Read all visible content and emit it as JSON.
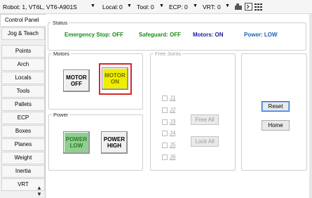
{
  "toolbar": {
    "robot_label": "Robot: 1, VT6L, VT6-A901S",
    "local_label": "Local:",
    "local_value": "0",
    "tool_label": "Tool:",
    "tool_value": "0",
    "ecp_label": "ECP:",
    "ecp_value": "0",
    "vrt_label": "VRT:",
    "vrt_value": "0",
    "arrow": "▼"
  },
  "sidebar": {
    "items": [
      {
        "label": "Control Panel"
      },
      {
        "label": "Jog & Teach"
      },
      {
        "label": "Points"
      },
      {
        "label": "Arch"
      },
      {
        "label": "Locals"
      },
      {
        "label": "Tools"
      },
      {
        "label": "Pallets"
      },
      {
        "label": "ECP"
      },
      {
        "label": "Boxes"
      },
      {
        "label": "Planes"
      },
      {
        "label": "Weight"
      },
      {
        "label": "Inertia"
      },
      {
        "label": "VRT"
      }
    ]
  },
  "status": {
    "title": "Status",
    "emergency_stop": "Emergency Stop: OFF",
    "safeguard": "Safeguard: OFF",
    "motors": "Motors: ON",
    "power": "Power: LOW",
    "colors": {
      "ok": "#1a8a1a",
      "accent": "#1a1aa0",
      "brand": "#1a5fb4"
    }
  },
  "motors": {
    "title": "Motors",
    "off_line1": "MOTOR",
    "off_line2": "OFF",
    "on_line1": "MOTOR",
    "on_line2": "ON"
  },
  "power": {
    "title": "Power",
    "low_line1": "POWER",
    "low_line2": "LOW",
    "high_line1": "POWER",
    "high_line2": "HIGH"
  },
  "free_joints": {
    "title": "Free Joints",
    "joints": [
      "J1",
      "J2",
      "J3",
      "J4",
      "J5",
      "J6"
    ],
    "free_all": "Free All",
    "lock_all": "Lock All"
  },
  "actions": {
    "reset": "Reset",
    "home": "Home"
  }
}
